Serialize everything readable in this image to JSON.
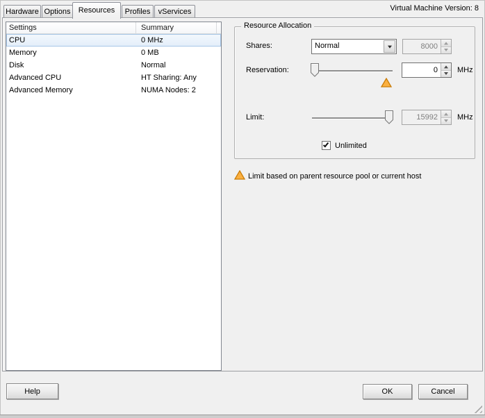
{
  "window": {
    "version": "Virtual Machine Version: 8"
  },
  "tabs": {
    "hardware": "Hardware",
    "options": "Options",
    "resources": "Resources",
    "profiles": "Profiles",
    "vservices": "vServices",
    "active_tab": "Resources"
  },
  "list": {
    "headers": {
      "settings": "Settings",
      "summary": "Summary"
    },
    "rows": [
      {
        "setting": "CPU",
        "summary": "0 MHz",
        "selected": true
      },
      {
        "setting": "Memory",
        "summary": "0 MB",
        "selected": false
      },
      {
        "setting": "Disk",
        "summary": "Normal",
        "selected": false
      },
      {
        "setting": "Advanced CPU",
        "summary": "HT Sharing: Any",
        "selected": false
      },
      {
        "setting": "Advanced Memory",
        "summary": "NUMA Nodes: 2",
        "selected": false
      }
    ]
  },
  "resource_allocation": {
    "title": "Resource Allocation",
    "shares_label": "Shares:",
    "shares_selected_option": "Normal",
    "shares_value": "8000",
    "shares_value_disabled": true,
    "reservation_label": "Reservation:",
    "reservation_value": "0",
    "reservation_unit": "MHz",
    "reservation_slider_position": "min",
    "limit_label": "Limit:",
    "limit_value": "15992",
    "limit_unit": "MHz",
    "limit_slider_position": "max",
    "limit_value_disabled": true,
    "unlimited_label": "Unlimited",
    "unlimited_checked": true
  },
  "note": {
    "text": "Limit based on parent resource pool or current host"
  },
  "footer": {
    "help": "Help",
    "ok": "OK",
    "cancel": "Cancel"
  },
  "colors": {
    "selection_bg": "#e8f1fb",
    "selection_border": "#a7c6e7",
    "warning_fill": "#fbb040",
    "warning_stroke": "#c97c08",
    "dialog_bg": "#f0f0f0"
  }
}
